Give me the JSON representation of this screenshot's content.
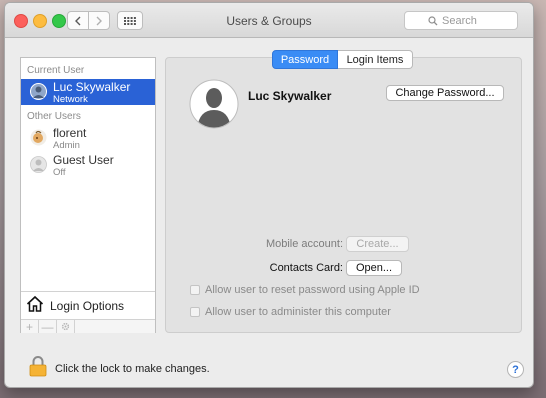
{
  "window": {
    "title": "Users & Groups"
  },
  "toolbar": {
    "back_icon": "chevron-left-icon",
    "forward_icon": "chevron-right-icon",
    "grid_icon": "grid-icon",
    "search_placeholder": "Search"
  },
  "sidebar": {
    "current_user_header": "Current User",
    "other_users_header": "Other Users",
    "users": [
      {
        "name": "Luc Skywalker",
        "role": "Network",
        "selected": true
      },
      {
        "name": "florent",
        "role": "Admin",
        "selected": false
      },
      {
        "name": "Guest User",
        "role": "Off",
        "selected": false
      }
    ],
    "login_options_label": "Login Options",
    "add_label": "+",
    "remove_label": "—",
    "action_icon": "gear-icon"
  },
  "tabs": [
    {
      "label": "Password",
      "active": true
    },
    {
      "label": "Login Items",
      "active": false
    }
  ],
  "detail": {
    "full_name": "Luc Skywalker",
    "change_password_label": "Change Password...",
    "mobile_account_label": "Mobile account:",
    "create_label": "Create...",
    "contacts_card_label": "Contacts Card:",
    "open_label": "Open...",
    "reset_password_checkbox": "Allow user to reset password using Apple ID",
    "administer_checkbox": "Allow user to administer this computer"
  },
  "footer": {
    "lock_text": "Click the lock to make changes.",
    "help_label": "?"
  },
  "colors": {
    "selection": "#2a62d6",
    "tab_active": "#3a8cf5"
  }
}
